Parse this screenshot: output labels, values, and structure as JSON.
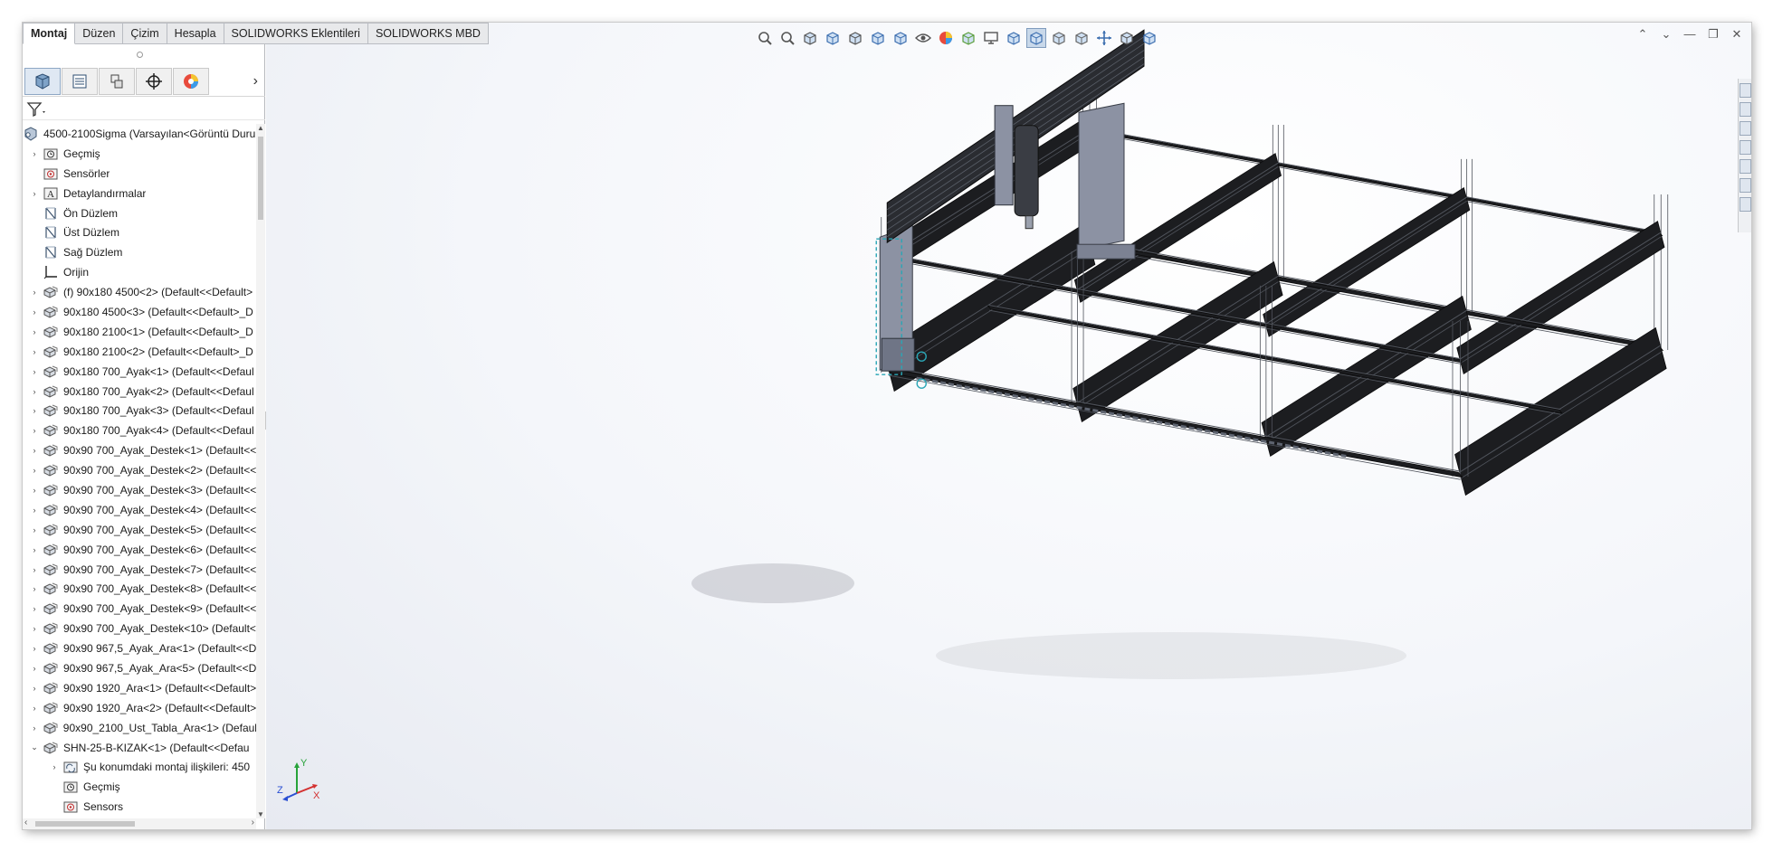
{
  "tabs": [
    "Montaj",
    "Düzen",
    "Çizim",
    "Hesapla",
    "SOLIDWORKS Eklentileri",
    "SOLIDWORKS MBD"
  ],
  "panel": {
    "tabs": [
      "feature-manager-icon",
      "property-manager-icon",
      "configuration-manager-icon",
      "dimxpert-manager-icon",
      "display-manager-icon"
    ],
    "next_glyph": "›",
    "filter_icon": "filter-icon"
  },
  "tree": [
    {
      "label": "4500-2100Sigma  (Varsayılan<Görüntü Duru",
      "icon": "assembly-icon",
      "exp": "",
      "indent": 0
    },
    {
      "label": "Geçmiş",
      "icon": "history-folder-icon",
      "exp": "›",
      "indent": 1
    },
    {
      "label": "Sensörler",
      "icon": "sensor-icon",
      "exp": "",
      "indent": 1
    },
    {
      "label": "Detaylandırmalar",
      "icon": "annotation-icon",
      "exp": "›",
      "indent": 1
    },
    {
      "label": "Ön Düzlem",
      "icon": "plane-icon",
      "exp": "",
      "indent": 1
    },
    {
      "label": "Üst Düzlem",
      "icon": "plane-icon",
      "exp": "",
      "indent": 1
    },
    {
      "label": "Sağ Düzlem",
      "icon": "plane-icon",
      "exp": "",
      "indent": 1
    },
    {
      "label": "Orijin",
      "icon": "origin-icon",
      "exp": "",
      "indent": 1
    },
    {
      "label": "(f) 90x180 4500<2> (Default<<Default>",
      "icon": "part-icon",
      "exp": "›",
      "indent": 1
    },
    {
      "label": "90x180 4500<3> (Default<<Default>_D",
      "icon": "part-icon",
      "exp": "›",
      "indent": 1
    },
    {
      "label": "90x180 2100<1> (Default<<Default>_D",
      "icon": "part-icon",
      "exp": "›",
      "indent": 1
    },
    {
      "label": "90x180 2100<2> (Default<<Default>_D",
      "icon": "part-icon",
      "exp": "›",
      "indent": 1
    },
    {
      "label": "90x180 700_Ayak<1> (Default<<Defaul",
      "icon": "part-icon",
      "exp": "›",
      "indent": 1
    },
    {
      "label": "90x180 700_Ayak<2> (Default<<Defaul",
      "icon": "part-icon",
      "exp": "›",
      "indent": 1
    },
    {
      "label": "90x180 700_Ayak<3> (Default<<Defaul",
      "icon": "part-icon",
      "exp": "›",
      "indent": 1
    },
    {
      "label": "90x180 700_Ayak<4> (Default<<Defaul",
      "icon": "part-icon",
      "exp": "›",
      "indent": 1
    },
    {
      "label": "90x90 700_Ayak_Destek<1> (Default<<",
      "icon": "part-icon",
      "exp": "›",
      "indent": 1
    },
    {
      "label": "90x90 700_Ayak_Destek<2> (Default<<",
      "icon": "part-icon",
      "exp": "›",
      "indent": 1
    },
    {
      "label": "90x90 700_Ayak_Destek<3> (Default<<",
      "icon": "part-icon",
      "exp": "›",
      "indent": 1
    },
    {
      "label": "90x90 700_Ayak_Destek<4> (Default<<",
      "icon": "part-icon",
      "exp": "›",
      "indent": 1
    },
    {
      "label": "90x90 700_Ayak_Destek<5> (Default<<",
      "icon": "part-icon",
      "exp": "›",
      "indent": 1
    },
    {
      "label": "90x90 700_Ayak_Destek<6> (Default<<",
      "icon": "part-icon",
      "exp": "›",
      "indent": 1
    },
    {
      "label": "90x90 700_Ayak_Destek<7> (Default<<",
      "icon": "part-icon",
      "exp": "›",
      "indent": 1
    },
    {
      "label": "90x90 700_Ayak_Destek<8> (Default<<",
      "icon": "part-icon",
      "exp": "›",
      "indent": 1
    },
    {
      "label": "90x90 700_Ayak_Destek<9> (Default<<",
      "icon": "part-icon",
      "exp": "›",
      "indent": 1
    },
    {
      "label": "90x90 700_Ayak_Destek<10> (Default<",
      "icon": "part-icon",
      "exp": "›",
      "indent": 1
    },
    {
      "label": "90x90 967,5_Ayak_Ara<1> (Default<<D",
      "icon": "part-icon",
      "exp": "›",
      "indent": 1
    },
    {
      "label": "90x90 967,5_Ayak_Ara<5> (Default<<D",
      "icon": "part-icon",
      "exp": "›",
      "indent": 1
    },
    {
      "label": "90x90 1920_Ara<1> (Default<<Default>",
      "icon": "part-icon",
      "exp": "›",
      "indent": 1
    },
    {
      "label": "90x90 1920_Ara<2> (Default<<Default>",
      "icon": "part-icon",
      "exp": "›",
      "indent": 1
    },
    {
      "label": "90x90_2100_Ust_Tabla_Ara<1> (Default",
      "icon": "part-icon",
      "exp": "›",
      "indent": 1
    },
    {
      "label": "SHN-25-B-KIZAK<1> (Default<<Defau",
      "icon": "part-icon",
      "exp": "⌄",
      "indent": 1
    },
    {
      "label": "Şu konumdaki montaj ilişkileri: 450",
      "icon": "mates-folder-icon",
      "exp": "›",
      "indent": 2
    },
    {
      "label": "Geçmiş",
      "icon": "history-folder-icon",
      "exp": "",
      "indent": 2
    },
    {
      "label": "Sensors",
      "icon": "sensor-icon",
      "exp": "",
      "indent": 2
    }
  ],
  "headsup_icons": [
    "zoom-to-fit-icon",
    "zoom-area-icon",
    "previous-view-icon",
    "section-view-icon",
    "dynamic-annotation-icon",
    "view-orientation-icon",
    "display-style-icon",
    "hide-show-icon",
    "edit-appearance-icon",
    "apply-scene-icon",
    "view-settings-icon",
    "isometric-view-icon",
    "shaded-with-edges-icon",
    "hidden-lines-icon",
    "wireframe-icon",
    "pan-icon",
    "rotate-icon",
    "normal-to-icon"
  ],
  "window_controls": [
    "⌃",
    "⌄",
    "—",
    "❐",
    "✕"
  ],
  "triad": {
    "x": "X",
    "y": "Y",
    "z": "Z"
  },
  "colors": {
    "profile": "#1c1d20",
    "profile_edge": "#50545c",
    "gantry": "#8c92a3",
    "selected": "#2aa6b6"
  }
}
